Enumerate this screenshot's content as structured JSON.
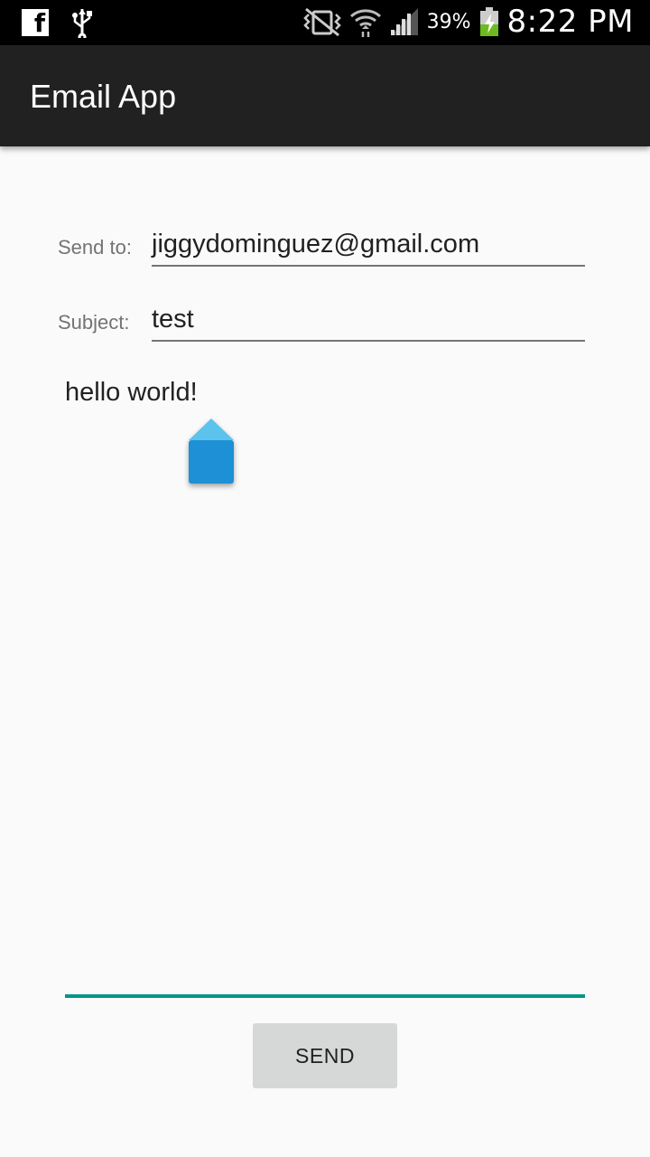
{
  "status_bar": {
    "icons_left": [
      "facebook-icon",
      "usb-icon"
    ],
    "icons_right": [
      "vibrate-icon",
      "wifi-icon",
      "signal-icon",
      "battery-charging-icon"
    ],
    "battery_percent": "39%",
    "time": "8:22 PM"
  },
  "app_bar": {
    "title": "Email App"
  },
  "form": {
    "send_to_label": "Send to:",
    "send_to_value": "jiggydominguez@gmail.com",
    "subject_label": "Subject:",
    "subject_value": "test",
    "message_value": "hello world!"
  },
  "actions": {
    "send_label": "SEND"
  },
  "colors": {
    "app_bar": "#212121",
    "accent": "#009688",
    "cursor_handle": "#1e90d6",
    "button": "#d6d7d7"
  }
}
